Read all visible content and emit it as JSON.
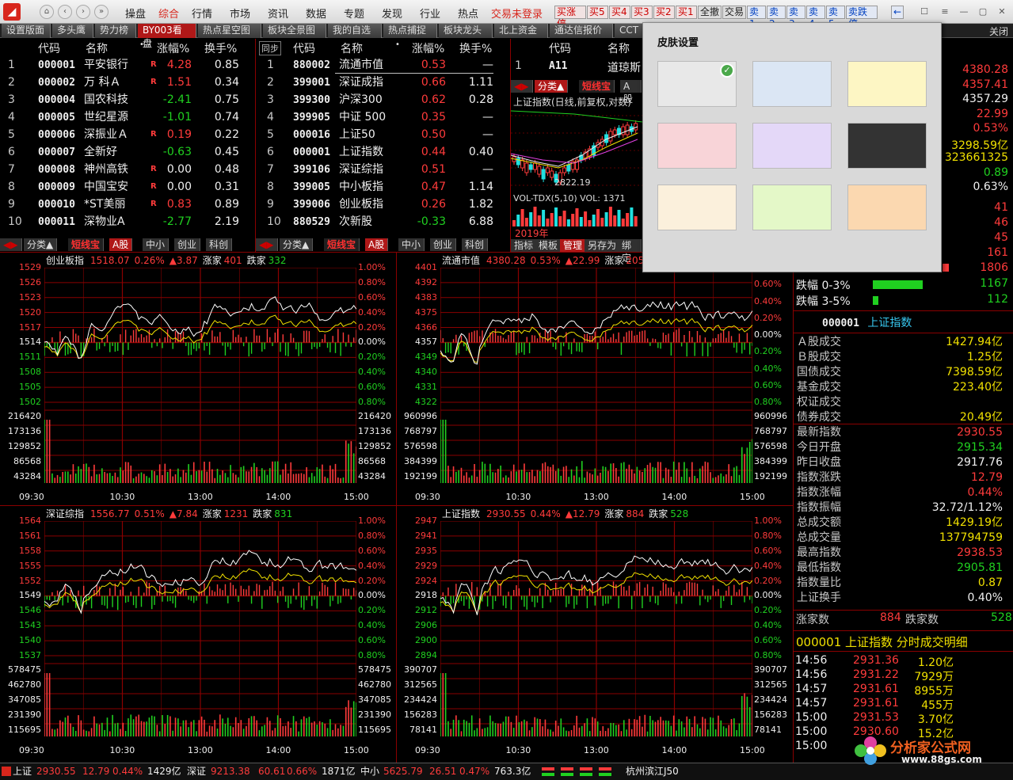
{
  "menu": {
    "items": [
      "操盘",
      "综合",
      "行情",
      "市场",
      "资讯",
      "数据",
      "专题",
      "发现",
      "行业",
      "热点"
    ],
    "active": "综合",
    "login": "交易未登录",
    "trade_buttons": [
      "买涨停",
      "买5",
      "买4",
      "买3",
      "买2",
      "买1",
      "全撤",
      "交易",
      "卖1",
      "卖2",
      "卖3",
      "卖4",
      "卖5",
      "卖跌停"
    ],
    "arrow": "←"
  },
  "tabs": [
    "设置版面",
    "多头鹰",
    "势力榜",
    "BY003看盘",
    "热点星空图",
    "板块全景图",
    "我的自选",
    "热点捕捉",
    "板块龙头",
    "北上资金",
    "通达信报价",
    "CCT"
  ],
  "close_label": "关闭",
  "stocks": {
    "headers": [
      "代码",
      "名称",
      "•",
      "涨幅%",
      "换手%"
    ],
    "rows": [
      {
        "n": "1",
        "code": "000001",
        "name": "平安银行",
        "flag": "R",
        "chg": "4.28",
        "turn": "0.85",
        "dir": "up"
      },
      {
        "n": "2",
        "code": "000002",
        "name": "万 科Ａ",
        "flag": "R",
        "chg": "1.51",
        "turn": "0.34",
        "dir": "up"
      },
      {
        "n": "3",
        "code": "000004",
        "name": "国农科技",
        "flag": "",
        "chg": "-2.41",
        "turn": "0.75",
        "dir": "down"
      },
      {
        "n": "4",
        "code": "000005",
        "name": "世纪星源",
        "flag": "",
        "chg": "-1.01",
        "turn": "0.74",
        "dir": "down"
      },
      {
        "n": "5",
        "code": "000006",
        "name": "深振业Ａ",
        "flag": "R",
        "chg": "0.19",
        "turn": "0.22",
        "dir": "up"
      },
      {
        "n": "6",
        "code": "000007",
        "name": "全新好",
        "flag": "",
        "chg": "-0.63",
        "turn": "0.45",
        "dir": "down"
      },
      {
        "n": "7",
        "code": "000008",
        "name": "神州高铁",
        "flag": "R",
        "chg": "0.00",
        "turn": "0.48",
        "dir": "flat"
      },
      {
        "n": "8",
        "code": "000009",
        "name": "中国宝安",
        "flag": "R",
        "chg": "0.00",
        "turn": "0.31",
        "dir": "flat"
      },
      {
        "n": "9",
        "code": "000010",
        "name": "*ST美丽",
        "flag": "R",
        "chg": "0.83",
        "turn": "0.89",
        "dir": "up"
      },
      {
        "n": "10",
        "code": "000011",
        "name": "深物业A",
        "flag": "",
        "chg": "-2.77",
        "turn": "2.19",
        "dir": "down"
      }
    ]
  },
  "indices": {
    "sync": "同步",
    "headers": [
      "代码",
      "名称",
      "•",
      "涨幅%",
      "换手%"
    ],
    "rows": [
      {
        "n": "1",
        "code": "880002",
        "name": "流通市值",
        "chg": "0.53",
        "turn": "—",
        "dir": "up"
      },
      {
        "n": "2",
        "code": "399001",
        "name": "深证成指",
        "chg": "0.66",
        "turn": "1.11",
        "dir": "up"
      },
      {
        "n": "3",
        "code": "399300",
        "name": "沪深300",
        "chg": "0.62",
        "turn": "0.28",
        "dir": "up"
      },
      {
        "n": "4",
        "code": "399905",
        "name": "中证 500",
        "chg": "0.35",
        "turn": "—",
        "dir": "up"
      },
      {
        "n": "5",
        "code": "000016",
        "name": "上证50",
        "chg": "0.50",
        "turn": "—",
        "dir": "up"
      },
      {
        "n": "6",
        "code": "000001",
        "name": "上证指数",
        "chg": "0.44",
        "turn": "0.40",
        "dir": "up"
      },
      {
        "n": "7",
        "code": "399106",
        "name": "深证综指",
        "chg": "0.51",
        "turn": "—",
        "dir": "up"
      },
      {
        "n": "8",
        "code": "399005",
        "name": "中小板指",
        "chg": "0.47",
        "turn": "1.14",
        "dir": "up"
      },
      {
        "n": "9",
        "code": "399006",
        "name": "创业板指",
        "chg": "0.26",
        "turn": "1.82",
        "dir": "up"
      },
      {
        "n": "10",
        "code": "880529",
        "name": "次新股",
        "chg": "-0.33",
        "turn": "6.88",
        "dir": "down"
      }
    ]
  },
  "global": {
    "headers": [
      "代码",
      "名称"
    ],
    "code": "A11",
    "name": "道琼斯"
  },
  "mini_tabs": [
    "分类▲",
    "短线宝",
    "A股",
    "中小",
    "创业",
    "科创"
  ],
  "kline": {
    "title": "上证指数(日线,前复权,对数)",
    "low_label": "2822.19",
    "vol_label": "VOL-TDX(5,10)  VOL: 1371",
    "year": "2019年",
    "bottom_tabs": [
      "指标",
      "模板",
      "管理",
      "另存为",
      "绑定"
    ]
  },
  "right_top": [
    {
      "v": "4380.28",
      "c": "up"
    },
    {
      "v": "4357.41",
      "c": "up"
    },
    {
      "v": "4357.29",
      "c": "wht"
    },
    {
      "v": "22.99",
      "c": "up"
    },
    {
      "v": "0.53%",
      "c": "up"
    },
    {
      "v": "3298.59亿",
      "c": "yel"
    },
    {
      "v": "323661325",
      "c": "yel"
    },
    {
      "v": "0.89",
      "c": "down"
    },
    {
      "v": "0.63%",
      "c": "wht"
    }
  ],
  "right_counts": [
    "41",
    "46",
    "45",
    "161",
    "1806"
  ],
  "drops": [
    {
      "label": "跌幅 0-3%",
      "value": "1167",
      "fill": 0.9
    },
    {
      "label": "跌幅 3-5%",
      "value": "112",
      "fill": 0.1
    }
  ],
  "index_info": {
    "code": "000001",
    "name": "上证指数",
    "rows": [
      {
        "k": "Ａ股成交",
        "v": "1427.94亿",
        "c": "yel"
      },
      {
        "k": "Ｂ股成交",
        "v": "1.25亿",
        "c": "yel"
      },
      {
        "k": "国债成交",
        "v": "7398.59亿",
        "c": "yel"
      },
      {
        "k": "基金成交",
        "v": "223.40亿",
        "c": "yel"
      },
      {
        "k": "权证成交",
        "v": "",
        "c": "yel"
      },
      {
        "k": "债券成交",
        "v": "20.49亿",
        "c": "yel"
      },
      {
        "k": "最新指数",
        "v": "2930.55",
        "c": "up"
      },
      {
        "k": "今日开盘",
        "v": "2915.34",
        "c": "down"
      },
      {
        "k": "昨日收盘",
        "v": "2917.76",
        "c": "wht"
      },
      {
        "k": "指数涨跌",
        "v": "12.79",
        "c": "up"
      },
      {
        "k": "指数涨幅",
        "v": "0.44%",
        "c": "up"
      },
      {
        "k": "指数振幅",
        "v": "32.72/1.12%",
        "c": "wht"
      },
      {
        "k": "总成交额",
        "v": "1429.19亿",
        "c": "yel"
      },
      {
        "k": "总成交量",
        "v": "137794759",
        "c": "yel"
      },
      {
        "k": "最高指数",
        "v": "2938.53",
        "c": "up"
      },
      {
        "k": "最低指数",
        "v": "2905.81",
        "c": "down"
      },
      {
        "k": "指数量比",
        "v": "0.87",
        "c": "yel"
      },
      {
        "k": "上证换手",
        "v": "0.40%",
        "c": "wht"
      }
    ],
    "rise_label": "涨家数",
    "rise": "884",
    "fall_label": "跌家数",
    "fall": "528"
  },
  "ticks": {
    "title": "000001 上证指数  分时成交明细",
    "rows": [
      {
        "t": "14:56",
        "p": "2931.36",
        "v": "1.20亿"
      },
      {
        "t": "14:56",
        "p": "2931.22",
        "v": "7929万"
      },
      {
        "t": "14:57",
        "p": "2931.61",
        "v": "8955万"
      },
      {
        "t": "14:57",
        "p": "2931.61",
        "v": "455万"
      },
      {
        "t": "15:00",
        "p": "2931.53",
        "v": "3.70亿"
      },
      {
        "t": "15:00",
        "p": "2930.60",
        "v": "15.2亿"
      },
      {
        "t": "15:00",
        "p": "",
        "v": ""
      }
    ]
  },
  "charts": [
    {
      "name": "创业板指",
      "price": "1518.07",
      "pct": "0.26%",
      "delta": "▲3.87",
      "rise_label": "涨家",
      "rise": "401",
      "fall_label": "跌家",
      "fall": "332",
      "prices": [
        "1529",
        "1526",
        "1523",
        "1520",
        "1517",
        "1514",
        "1511",
        "1508",
        "1505",
        "1502"
      ],
      "mid_price": "1514",
      "pcts": [
        "1.00%",
        "0.80%",
        "0.60%",
        "0.40%",
        "0.20%",
        "0.00%",
        "0.20%",
        "0.40%",
        "0.60%",
        "0.80%"
      ],
      "vols": [
        "216420",
        "173136",
        "129852",
        "86568",
        "43284"
      ]
    },
    {
      "name": "流通市值",
      "price": "4380.28",
      "pct": "0.53%",
      "delta": "▲22.99",
      "rise_label": "涨家",
      "rise": "2058",
      "fall_label": "",
      "fall": "",
      "prices": [
        "4401",
        "4392",
        "4383",
        "4375",
        "4366",
        "4357",
        "4349",
        "4340",
        "4331",
        "4322"
      ],
      "mid_price": "4357",
      "pcts": [
        "0.80%",
        "0.60%",
        "0.40%",
        "0.20%",
        "0.00%",
        "0.20%",
        "0.40%",
        "0.60%",
        "0.80%"
      ],
      "vols": [
        "960996",
        "768797",
        "576598",
        "384399",
        "192199"
      ]
    },
    {
      "name": "深证综指",
      "price": "1556.77",
      "pct": "0.51%",
      "delta": "▲7.84",
      "rise_label": "涨家",
      "rise": "1231",
      "fall_label": "跌家",
      "fall": "831",
      "prices": [
        "1564",
        "1561",
        "1558",
        "1555",
        "1552",
        "1549",
        "1546",
        "1543",
        "1540",
        "1537"
      ],
      "mid_price": "1549",
      "pcts": [
        "1.00%",
        "0.80%",
        "0.60%",
        "0.40%",
        "0.20%",
        "0.00%",
        "0.20%",
        "0.40%",
        "0.60%",
        "0.80%"
      ],
      "vols": [
        "578475",
        "462780",
        "347085",
        "231390",
        "115695"
      ]
    },
    {
      "name": "上证指数",
      "price": "2930.55",
      "pct": "0.44%",
      "delta": "▲12.79",
      "rise_label": "涨家",
      "rise": "884",
      "fall_label": "跌家",
      "fall": "528",
      "prices": [
        "2947",
        "2941",
        "2935",
        "2929",
        "2924",
        "2918",
        "2912",
        "2906",
        "2900",
        "2894"
      ],
      "mid_price": "2918",
      "pcts": [
        "1.00%",
        "0.80%",
        "0.60%",
        "0.40%",
        "0.20%",
        "0.00%",
        "0.20%",
        "0.40%",
        "0.60%",
        "0.80%"
      ],
      "vols": [
        "390707",
        "312565",
        "234424",
        "156283",
        "78141"
      ]
    }
  ],
  "time_labels": [
    "09:30",
    "10:30",
    "13:00",
    "14:00",
    "15:00"
  ],
  "status": {
    "sh": {
      "name": "上证",
      "price": "2930.55",
      "chg": "12.79",
      "pct": "0.44%",
      "amt": "1429亿"
    },
    "sz": {
      "name": "深证",
      "price": "9213.38",
      "chg": "60.61",
      "pct": "0.66%",
      "amt": "1871亿"
    },
    "zx": {
      "name": "中小",
      "price": "5625.79",
      "chg": "26.51",
      "pct": "0.47%",
      "amt": "763.3亿"
    },
    "server": "杭州滨江J50"
  },
  "skin": {
    "title": "皮肤设置",
    "colors": [
      "#e8e8e8",
      "#dbe6f4",
      "#fdf6c4",
      "#f8d4d8",
      "#e4d8f8",
      "#333333",
      "#fbf0dc",
      "#e4f8c8",
      "#fbd8b0"
    ],
    "selected": 0
  },
  "watermark": {
    "text": "分析家公式网",
    "url": "www.88gs.com"
  },
  "colors": {
    "up": "#ff3b3b",
    "down": "#20d020",
    "grid": "#8a0000",
    "price_line": "#ffffff",
    "avg_line": "#f0e000"
  }
}
